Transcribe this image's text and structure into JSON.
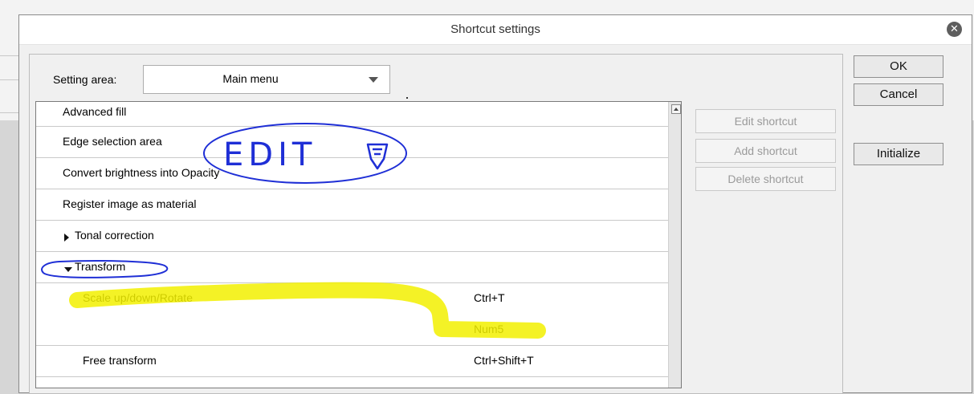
{
  "window": {
    "title": "Shortcut settings"
  },
  "setting_area": {
    "label": "Setting area:",
    "selected": "Main menu"
  },
  "list": {
    "rows": [
      {
        "label": "Advanced fill",
        "shortcut": ""
      },
      {
        "label": "Edge selection area",
        "shortcut": ""
      },
      {
        "label": "Convert brightness into Opacity",
        "shortcut": ""
      },
      {
        "label": "Register image as material",
        "shortcut": ""
      },
      {
        "label": "Tonal correction",
        "shortcut": "",
        "expander": "collapsed"
      },
      {
        "label": "Transform",
        "shortcut": "",
        "expander": "expanded"
      },
      {
        "label": "Scale up/down/Rotate",
        "shortcut": "Ctrl+T"
      },
      {
        "label": "",
        "shortcut": "Num5"
      },
      {
        "label": "Free transform",
        "shortcut": "Ctrl+Shift+T"
      }
    ]
  },
  "shortcut_buttons": {
    "edit": "Edit shortcut",
    "add": "Add shortcut",
    "delete": "Delete shortcut"
  },
  "dialog_buttons": {
    "ok": "OK",
    "cancel": "Cancel",
    "initialize": "Initialize"
  },
  "annotations": {
    "handwritten_note": "EDIT",
    "pen_color": "#1f2fd6",
    "highlight_color": "#f2f000"
  },
  "icons": {
    "close": "close-icon",
    "dropdown": "chevron-down-icon",
    "scroll_up": "scroll-up-icon"
  }
}
